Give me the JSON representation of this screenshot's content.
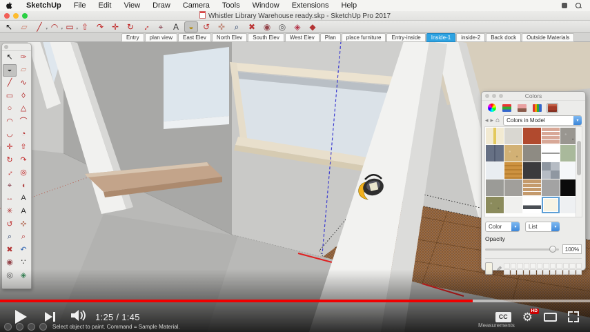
{
  "menu_bar": {
    "items": [
      "SketchUp",
      "File",
      "Edit",
      "View",
      "Draw",
      "Camera",
      "Tools",
      "Window",
      "Extensions",
      "Help"
    ]
  },
  "window": {
    "title": "Whistler Library Warehouse ready.skp - SketchUp Pro 2017"
  },
  "toolbar": {
    "tools": [
      {
        "name": "select",
        "glyph": "↖",
        "color": "#111"
      },
      {
        "name": "eraser",
        "glyph": "▱",
        "color": "#d08878"
      },
      {
        "name": "line",
        "glyph": "╱",
        "color": "#b22222",
        "dropdown": true
      },
      {
        "name": "arc",
        "glyph": "◠",
        "color": "#b22222",
        "dropdown": true
      },
      {
        "name": "rectangle",
        "glyph": "▭",
        "color": "#b22222",
        "dropdown": true
      },
      {
        "name": "push-pull",
        "glyph": "⇧",
        "color": "#c02222"
      },
      {
        "name": "follow-me",
        "glyph": "↷",
        "color": "#c02222"
      },
      {
        "name": "move",
        "glyph": "✛",
        "color": "#c02222"
      },
      {
        "name": "rotate",
        "glyph": "↻",
        "color": "#c02222"
      },
      {
        "name": "scale",
        "glyph": "↔",
        "color": "#c02222",
        "rotate": true
      },
      {
        "name": "tape-measure",
        "glyph": "⌖",
        "color": "#7a2a3a"
      },
      {
        "name": "text",
        "glyph": "A",
        "color": "#333"
      },
      {
        "name": "paint-bucket",
        "glyph": "◒",
        "color": "#b08a10",
        "active": true
      },
      {
        "name": "orbit",
        "glyph": "↺",
        "color": "#c03333"
      },
      {
        "name": "pan",
        "glyph": "✜",
        "color": "#c08878"
      },
      {
        "name": "zoom",
        "glyph": "⌕",
        "color": "#223a66"
      },
      {
        "name": "zoom-extents",
        "glyph": "✖",
        "color": "#b33"
      },
      {
        "name": "position-camera",
        "glyph": "◉",
        "color": "#94444a"
      },
      {
        "name": "look-around",
        "glyph": "◎",
        "color": "#555"
      },
      {
        "name": "section-plane",
        "glyph": "◈",
        "color": "#b33348"
      },
      {
        "name": "materials",
        "glyph": "◆",
        "color": "#b33333"
      }
    ]
  },
  "scene_tabs": {
    "active_index": 9,
    "tabs": [
      "Entry",
      "plan view",
      "East Elev",
      "North Elev",
      "South Elev",
      "West Elev",
      "Plan",
      "place furniture",
      "Entry-inside",
      "Inside-1",
      "inside-2",
      "Back dock",
      "Outside Materials"
    ]
  },
  "tool_palette": {
    "tools": [
      {
        "name": "select",
        "glyph": "↖",
        "color": "#111"
      },
      {
        "name": "lasso",
        "glyph": "✑",
        "color": "#c04444"
      },
      {
        "name": "paint-bucket",
        "glyph": "◒",
        "color": "#333",
        "active": true
      },
      {
        "name": "eraser",
        "glyph": "▱",
        "color": "#d08878"
      },
      {
        "name": "line",
        "glyph": "╱",
        "color": "#b22222"
      },
      {
        "name": "freehand",
        "glyph": "∿",
        "color": "#b22222"
      },
      {
        "name": "rectangle",
        "glyph": "▭",
        "color": "#b22222"
      },
      {
        "name": "rotated-rectangle",
        "glyph": "◊",
        "color": "#b22222"
      },
      {
        "name": "circle",
        "glyph": "○",
        "color": "#b22222"
      },
      {
        "name": "polygon",
        "glyph": "△",
        "color": "#b22222"
      },
      {
        "name": "arc",
        "glyph": "◠",
        "color": "#b22222"
      },
      {
        "name": "two-point-arc",
        "glyph": "⌒",
        "color": "#b22222"
      },
      {
        "name": "three-point-arc",
        "glyph": "◡",
        "color": "#b22222"
      },
      {
        "name": "pie",
        "glyph": "◔",
        "color": "#b22222"
      },
      {
        "name": "move",
        "glyph": "✛",
        "color": "#c02222"
      },
      {
        "name": "push-pull",
        "glyph": "⇧",
        "color": "#c02222"
      },
      {
        "name": "rotate",
        "glyph": "↻",
        "color": "#c02222"
      },
      {
        "name": "follow-me",
        "glyph": "↷",
        "color": "#c02222"
      },
      {
        "name": "scale",
        "glyph": "↔",
        "color": "#c02222",
        "rotate": true
      },
      {
        "name": "offset",
        "glyph": "◎",
        "color": "#c02222"
      },
      {
        "name": "tape-measure",
        "glyph": "⌖",
        "color": "#7a2a3a"
      },
      {
        "name": "protractor",
        "glyph": "◖",
        "color": "#b04444"
      },
      {
        "name": "dimension",
        "glyph": "↔",
        "color": "#b04444"
      },
      {
        "name": "text",
        "glyph": "A",
        "color": "#333"
      },
      {
        "name": "axes",
        "glyph": "✳",
        "color": "#b33333"
      },
      {
        "name": "3d-text",
        "glyph": "A",
        "color": "#222"
      },
      {
        "name": "orbit",
        "glyph": "↺",
        "color": "#c03333"
      },
      {
        "name": "pan",
        "glyph": "✜",
        "color": "#c08878"
      },
      {
        "name": "zoom",
        "glyph": "⌕",
        "color": "#223a66"
      },
      {
        "name": "zoom-window",
        "glyph": "⌕",
        "color": "#b33333"
      },
      {
        "name": "zoom-extents",
        "glyph": "✖",
        "color": "#b33333"
      },
      {
        "name": "previous-view",
        "glyph": "↶",
        "color": "#3366b0"
      },
      {
        "name": "position-camera",
        "glyph": "◉",
        "color": "#94444a"
      },
      {
        "name": "walk",
        "glyph": "∵",
        "color": "#222"
      },
      {
        "name": "look-around",
        "glyph": "◎",
        "color": "#555"
      },
      {
        "name": "section-plane",
        "glyph": "◈",
        "color": "#3a8a5a"
      }
    ]
  },
  "colors_panel": {
    "title": "Colors",
    "tabs": [
      {
        "name": "color-wheel",
        "active": false
      },
      {
        "name": "color-sliders",
        "active": false
      },
      {
        "name": "image-palettes",
        "active": false
      },
      {
        "name": "crayons",
        "active": false
      },
      {
        "name": "brick-materials",
        "active": true
      }
    ],
    "dropdown_value": "Colors in Model",
    "swatches": [
      {
        "color": "#f2ead2",
        "pattern": "stripe"
      },
      {
        "color": "#d9d7d1"
      },
      {
        "color": "#b14a2e"
      },
      {
        "color": "#d8a897",
        "pattern": "brick"
      },
      {
        "color": "#999690",
        "pattern": "speckle"
      },
      {
        "color": "#667084",
        "pattern": "panels"
      },
      {
        "color": "#d2b175",
        "pattern": "speckle"
      },
      {
        "color": "#8e8b83"
      },
      {
        "color": "#ffffff",
        "pattern": "hline"
      },
      {
        "color": "#a9b99b"
      },
      {
        "color": "#e9edf1"
      },
      {
        "color": "#cd9240",
        "pattern": "wood"
      },
      {
        "color": "#3b3b3d"
      },
      {
        "color": "#9aa0a8",
        "pattern": "checker"
      },
      {
        "color": "#f5f7f9"
      },
      {
        "color": "#9b9b97"
      },
      {
        "color": "#a19f9b"
      },
      {
        "color": "#c49a6c",
        "pattern": "brick"
      },
      {
        "color": "#a3a3a3"
      },
      {
        "color": "#0b0b0b"
      },
      {
        "color": "#8b8b5c",
        "pattern": "speckle"
      },
      {
        "color": "#f0f0ee"
      },
      {
        "color": "#ffffff",
        "pattern": "bar"
      },
      {
        "color": "#f7f4e4",
        "selected": true
      },
      {
        "color": "#eef0f2"
      }
    ],
    "color_select": "Color",
    "list_select": "List",
    "opacity_label": "Opacity",
    "opacity_value": "100%"
  },
  "status_bar": {
    "message": "Select object to paint. Command = Sample Material.",
    "right_label": "Measurements"
  },
  "player": {
    "time_display": "1:25 / 1:45",
    "progress_percent": 80.1,
    "cc_label": "CC",
    "hd_label": "HD",
    "accent_color": "#f00000"
  }
}
